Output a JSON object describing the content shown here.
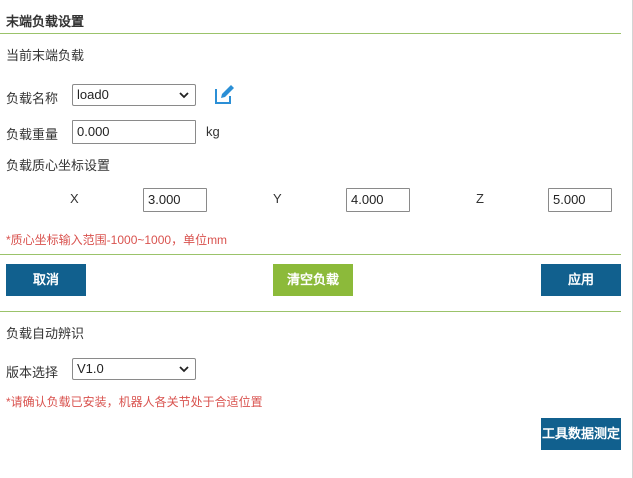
{
  "header": {
    "title": "末端负载设置"
  },
  "current_load": {
    "section_label": "当前末端负载",
    "name_label": "负载名称",
    "name_value": "load0",
    "weight_label": "负载重量",
    "weight_value": "0.000",
    "weight_unit": "kg",
    "com_label": "负载质心坐标设置",
    "x_label": "X",
    "x_value": "3.000",
    "y_label": "Y",
    "y_value": "4.000",
    "z_label": "Z",
    "z_value": "5.000",
    "note": "*质心坐标输入范围-1000~1000，单位mm"
  },
  "buttons": {
    "cancel": "取消",
    "clear": "清空负载",
    "apply": "应用",
    "tool_measure": "工具数据测定"
  },
  "auto_identify": {
    "section_label": "负载自动辨识",
    "version_label": "版本选择",
    "version_value": "V1.0",
    "note": "*请确认负载已安装，机器人各关节处于合适位置"
  },
  "colors": {
    "primary_button": "#11608e",
    "clear_button": "#8cba3a",
    "divider": "#9bc36a",
    "note_text": "#d9534f",
    "edit_icon": "#2b8fd6"
  },
  "icons": {
    "edit": "edit-icon",
    "dropdown": "chevron-down-icon"
  }
}
